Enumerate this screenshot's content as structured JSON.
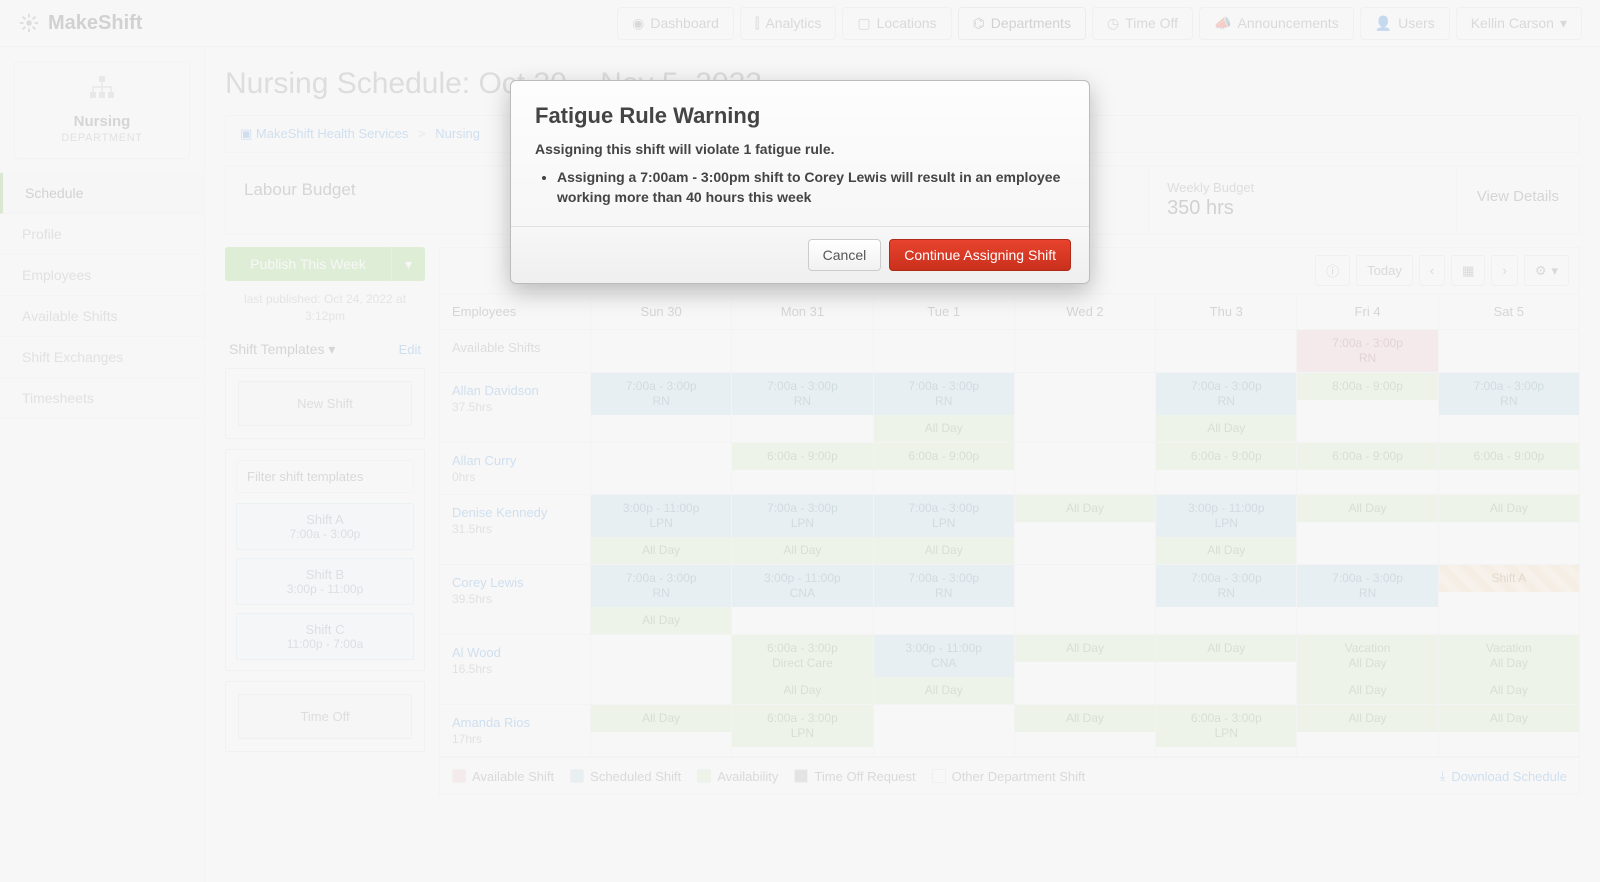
{
  "brand": "MakeShift",
  "nav": [
    {
      "label": "Dashboard",
      "icon": "dashboard"
    },
    {
      "label": "Analytics",
      "icon": "chart"
    },
    {
      "label": "Locations",
      "icon": "map"
    },
    {
      "label": "Departments",
      "icon": "sitemap",
      "active": true
    },
    {
      "label": "Time Off",
      "icon": "clock"
    },
    {
      "label": "Announcements",
      "icon": "bullhorn"
    },
    {
      "label": "Users",
      "icon": "user"
    }
  ],
  "user_menu": "Kellin Carson",
  "dept": {
    "name": "Nursing",
    "sub": "DEPARTMENT"
  },
  "sidenav": [
    "Schedule",
    "Profile",
    "Employees",
    "Available Shifts",
    "Shift Exchanges",
    "Timesheets"
  ],
  "sidenav_active": 0,
  "page_title": "Nursing Schedule: Oct 30 – Nov 5, 2022",
  "breadcrumb": {
    "org": "MakeShift Health Services",
    "dept": "Nursing"
  },
  "budget": {
    "label": "Labour Budget",
    "weekly_label": "Weekly Budget",
    "weekly_value": "350 hrs",
    "view_details": "View Details"
  },
  "publish": {
    "btn": "Publish This Week",
    "last": "last published: Oct 24, 2022 at 3:12pm"
  },
  "templates": {
    "header": "Shift Templates",
    "edit": "Edit",
    "new_shift": "New Shift",
    "filter_placeholder": "Filter shift templates",
    "list": [
      {
        "name": "Shift A",
        "time": "7:00a - 3:00p"
      },
      {
        "name": "Shift B",
        "time": "3:00p - 11:00p"
      },
      {
        "name": "Shift C",
        "time": "11:00p - 7:00a"
      }
    ],
    "time_off": "Time Off"
  },
  "toolbar": {
    "today": "Today"
  },
  "days": [
    "Sun 30",
    "Mon 31",
    "Tue 1",
    "Wed 2",
    "Thu 3",
    "Fri 4",
    "Sat 5"
  ],
  "employees_header": "Employees",
  "available_row": {
    "label": "Available Shifts",
    "cells": [
      null,
      null,
      null,
      null,
      null,
      {
        "t": "7:00a - 3:00p",
        "r": "RN",
        "c": "pink"
      },
      null
    ]
  },
  "rows": [
    {
      "name": "Allan Davidson",
      "hrs": "37.5hrs",
      "cells": [
        [
          {
            "t": "7:00a - 3:00p",
            "r": "RN",
            "c": "blue"
          }
        ],
        [
          {
            "t": "7:00a - 3:00p",
            "r": "RN",
            "c": "blue"
          }
        ],
        [
          {
            "t": "7:00a - 3:00p",
            "r": "RN",
            "c": "blue"
          },
          {
            "t": "All Day",
            "c": "grn"
          }
        ],
        [],
        [
          {
            "t": "7:00a - 3:00p",
            "r": "RN",
            "c": "blue"
          },
          {
            "t": "All Day",
            "c": "grn"
          }
        ],
        [
          {
            "t": "8:00a - 9:00p",
            "c": "grn"
          }
        ],
        [
          {
            "t": "7:00a - 3:00p",
            "r": "RN",
            "c": "blue"
          }
        ]
      ]
    },
    {
      "name": "Allan Curry",
      "hrs": "0hrs",
      "cells": [
        [],
        [
          {
            "t": "6:00a - 9:00p",
            "c": "grn"
          }
        ],
        [
          {
            "t": "6:00a - 9:00p",
            "c": "grn"
          }
        ],
        [],
        [
          {
            "t": "6:00a - 9:00p",
            "c": "grn"
          }
        ],
        [
          {
            "t": "6:00a - 9:00p",
            "c": "grn"
          }
        ],
        [
          {
            "t": "6:00a - 9:00p",
            "c": "grn"
          }
        ]
      ]
    },
    {
      "name": "Denise Kennedy",
      "hrs": "31.5hrs",
      "cells": [
        [
          {
            "t": "3:00p - 11:00p",
            "r": "LPN",
            "c": "blue"
          },
          {
            "t": "All Day",
            "c": "grn"
          }
        ],
        [
          {
            "t": "7:00a - 3:00p",
            "r": "LPN",
            "c": "blue"
          },
          {
            "t": "All Day",
            "c": "grn"
          }
        ],
        [
          {
            "t": "7:00a - 3:00p",
            "r": "LPN",
            "c": "blue"
          },
          {
            "t": "All Day",
            "c": "grn"
          }
        ],
        [
          {
            "t": "All Day",
            "c": "grn"
          }
        ],
        [
          {
            "t": "3:00p - 11:00p",
            "r": "LPN",
            "c": "blue"
          },
          {
            "t": "All Day",
            "c": "grn"
          }
        ],
        [
          {
            "t": "All Day",
            "c": "grn"
          }
        ],
        [
          {
            "t": "All Day",
            "c": "grn"
          }
        ]
      ]
    },
    {
      "name": "Corey Lewis",
      "hrs": "39.5hrs",
      "cells": [
        [
          {
            "t": "7:00a - 3:00p",
            "r": "RN",
            "c": "blue"
          },
          {
            "t": "All Day",
            "c": "grn"
          }
        ],
        [
          {
            "t": "3:00p - 11:00p",
            "r": "CNA",
            "c": "blue"
          }
        ],
        [
          {
            "t": "7:00a - 3:00p",
            "r": "RN",
            "c": "blue"
          }
        ],
        [],
        [
          {
            "t": "7:00a - 3:00p",
            "r": "RN",
            "c": "blue"
          }
        ],
        [
          {
            "t": "7:00a - 3:00p",
            "r": "RN",
            "c": "blue"
          }
        ],
        [
          {
            "t": "Shift A",
            "c": "orng"
          }
        ]
      ]
    },
    {
      "name": "Al Wood",
      "hrs": "16.5hrs",
      "cells": [
        [],
        [
          {
            "t": "6:00a - 3:00p",
            "r": "Direct Care",
            "c": "grn"
          },
          {
            "t": "All Day",
            "c": "grn"
          }
        ],
        [
          {
            "t": "3:00p - 11:00p",
            "r": "CNA",
            "c": "blue"
          },
          {
            "t": "All Day",
            "c": "grn"
          }
        ],
        [
          {
            "t": "All Day",
            "c": "grn"
          }
        ],
        [
          {
            "t": "All Day",
            "c": "grn"
          }
        ],
        [
          {
            "t": "Vacation",
            "r": "All Day",
            "c": "grn"
          },
          {
            "t": "All Day",
            "c": "grn"
          }
        ],
        [
          {
            "t": "Vacation",
            "r": "All Day",
            "c": "grn"
          },
          {
            "t": "All Day",
            "c": "grn"
          }
        ]
      ]
    },
    {
      "name": "Amanda Rios",
      "hrs": "17hrs",
      "cells": [
        [
          {
            "t": "All Day",
            "c": "grn"
          }
        ],
        [
          {
            "t": "6:00a - 3:00p",
            "r": "LPN",
            "c": "grn"
          }
        ],
        [],
        [
          {
            "t": "All Day",
            "c": "grn"
          }
        ],
        [
          {
            "t": "6:00a - 3:00p",
            "r": "LPN",
            "c": "grn"
          }
        ],
        [
          {
            "t": "All Day",
            "c": "grn"
          }
        ],
        [
          {
            "t": "All Day",
            "c": "grn"
          }
        ]
      ]
    }
  ],
  "legend": {
    "available": "Available Shift",
    "scheduled": "Scheduled Shift",
    "availability": "Availability",
    "timeoff": "Time Off Request",
    "other": "Other Department Shift",
    "download": "Download Schedule"
  },
  "modal": {
    "title": "Fatigue Rule Warning",
    "lead": "Assigning this shift will violate 1 fatigue rule.",
    "bullets": [
      "Assigning a 7:00am - 3:00pm shift to Corey Lewis will result in an employee working more than 40 hours this week"
    ],
    "cancel": "Cancel",
    "continue": "Continue Assigning Shift"
  }
}
